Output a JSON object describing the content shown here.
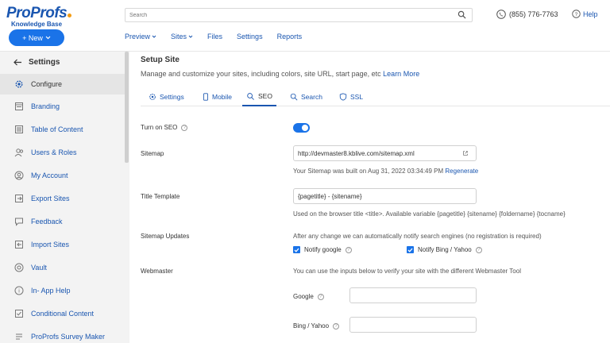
{
  "header": {
    "logo_text": "ProProfs",
    "logo_subtitle": "Knowledge Base",
    "new_label": "+ New",
    "search_placeholder": "Search",
    "phone": "(855) 776-7763",
    "help_label": "Help"
  },
  "topnav": [
    {
      "label": "Preview",
      "dropdown": true
    },
    {
      "label": "Sites",
      "dropdown": true
    },
    {
      "label": "Files",
      "dropdown": false
    },
    {
      "label": "Settings",
      "dropdown": false
    },
    {
      "label": "Reports",
      "dropdown": false
    }
  ],
  "sidebar": {
    "title": "Settings",
    "items": [
      {
        "label": "Configure",
        "icon": "gear-icon",
        "active": true
      },
      {
        "label": "Branding",
        "icon": "branding-icon"
      },
      {
        "label": "Table of Content",
        "icon": "toc-icon"
      },
      {
        "label": "Users & Roles",
        "icon": "users-icon"
      },
      {
        "label": "My Account",
        "icon": "account-icon"
      },
      {
        "label": "Export Sites",
        "icon": "export-icon"
      },
      {
        "label": "Feedback",
        "icon": "feedback-icon"
      },
      {
        "label": "Import Sites",
        "icon": "import-icon"
      },
      {
        "label": "Vault",
        "icon": "vault-icon"
      },
      {
        "label": "In- App Help",
        "icon": "help-icon"
      },
      {
        "label": "Conditional Content",
        "icon": "conditional-icon"
      },
      {
        "label": "ProProfs Survey Maker",
        "icon": "survey-icon"
      }
    ]
  },
  "main": {
    "title": "Setup Site",
    "description": "Manage and customize your sites, including colors, site URL, start page, etc",
    "learn_more": "Learn More",
    "tabs": [
      {
        "label": "Settings",
        "icon": "gear-icon"
      },
      {
        "label": "Mobile",
        "icon": "mobile-icon"
      },
      {
        "label": "SEO",
        "icon": "seo-icon",
        "active": true
      },
      {
        "label": "Search",
        "icon": "search-icon"
      },
      {
        "label": "SSL",
        "icon": "ssl-icon"
      }
    ]
  },
  "seo": {
    "turn_on_label": "Turn on SEO",
    "turn_on_value": true,
    "sitemap_label": "Sitemap",
    "sitemap_value": "http://devmaster8.kblive.com/sitemap.xml",
    "sitemap_note": "Your Sitemap was built on Aug 31, 2022 03:34:49 PM",
    "regenerate": "Regenerate",
    "title_template_label": "Title Template",
    "title_template_value": "{pagetitle} - {sitename}",
    "title_template_note": "Used on the browser title <title>. Available variable {pagetitle} {sitename} {foldername} {tocname}",
    "sitemap_updates_label": "Sitemap Updates",
    "sitemap_updates_note": "After any change we can automatically notify search engines (no registration is required)",
    "notify_google": "Notify google",
    "notify_google_checked": true,
    "notify_bing": "Notify Bing / Yahoo",
    "notify_bing_checked": true,
    "webmaster_label": "Webmaster",
    "webmaster_note": "You can use the inputs below to verify your site with the different Webmaster Tool",
    "google_label": "Google",
    "google_value": "",
    "bing_label": "Bing / Yahoo",
    "bing_value": ""
  },
  "colors": {
    "accent": "#1a73e8",
    "link": "#1a56b0",
    "sidebar_bg": "#f3f3f3"
  }
}
